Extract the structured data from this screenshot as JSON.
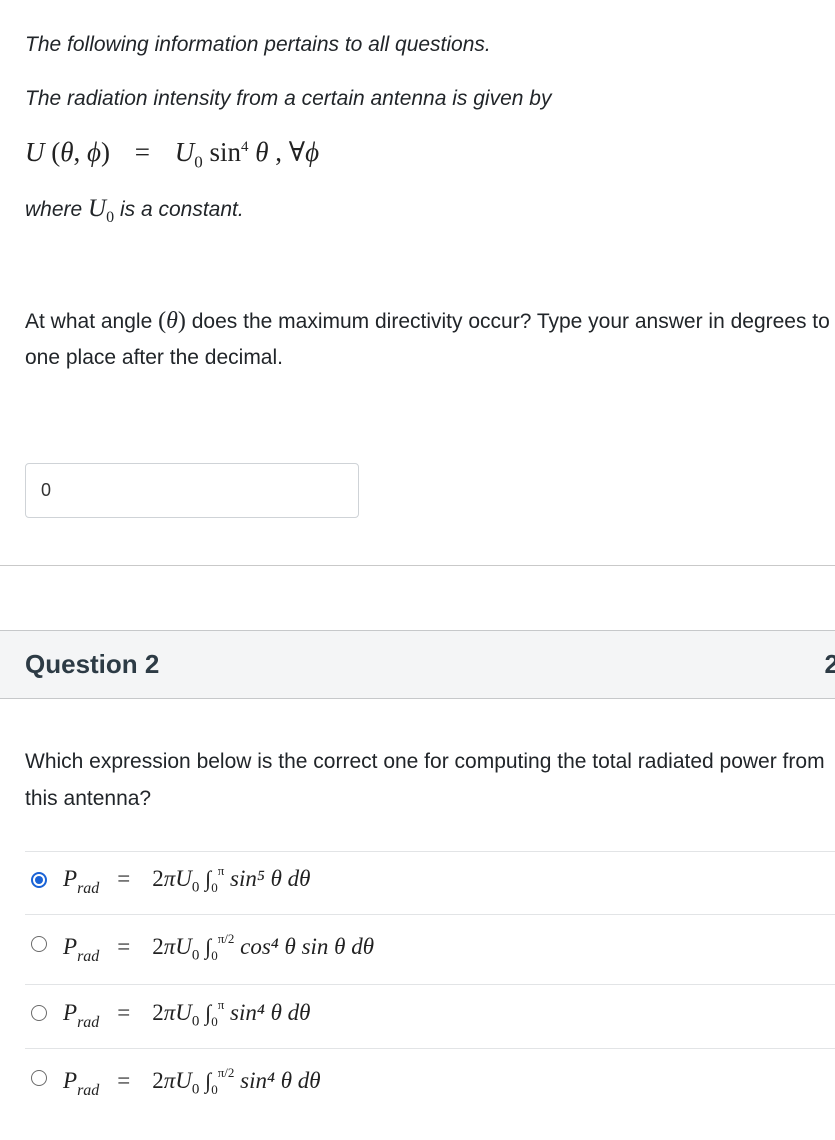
{
  "intro": {
    "line1": "The following information pertains to all questions.",
    "line2": "The radiation intensity from a certain antenna is given by",
    "where_prefix": "where",
    "where_suffix": "is a constant."
  },
  "question1": {
    "text_before": "At what angle",
    "text_after": "does the maximum directivity occur? Type your answer in degrees to one place after the decimal.",
    "answer_value": "0"
  },
  "question2": {
    "title": "Question 2",
    "points_partial": "2",
    "text": "Which expression below is the correct one for computing the total radiated power from this antenna?",
    "selected_index": 0,
    "options": [
      {
        "lower": "0",
        "upper": "π",
        "integrand": "sin⁵ θ dθ",
        "label": "2πU0 ∫0^π sin^5 θ dθ"
      },
      {
        "lower": "0",
        "upper": "π/2",
        "integrand": "cos⁴ θ sin θ dθ",
        "label": "2πU0 ∫0^π/2 cos^4 θ sin θ dθ"
      },
      {
        "lower": "0",
        "upper": "π",
        "integrand": "sin⁴ θ dθ",
        "label": "2πU0 ∫0^π sin^4 θ dθ"
      },
      {
        "lower": "0",
        "upper": "π/2",
        "integrand": "sin⁴ θ dθ",
        "label": "2πU0 ∫0^π/2 sin^4 θ dθ"
      }
    ]
  },
  "colors": {
    "accent": "#1a63d6",
    "header_bg": "#f4f5f6"
  }
}
